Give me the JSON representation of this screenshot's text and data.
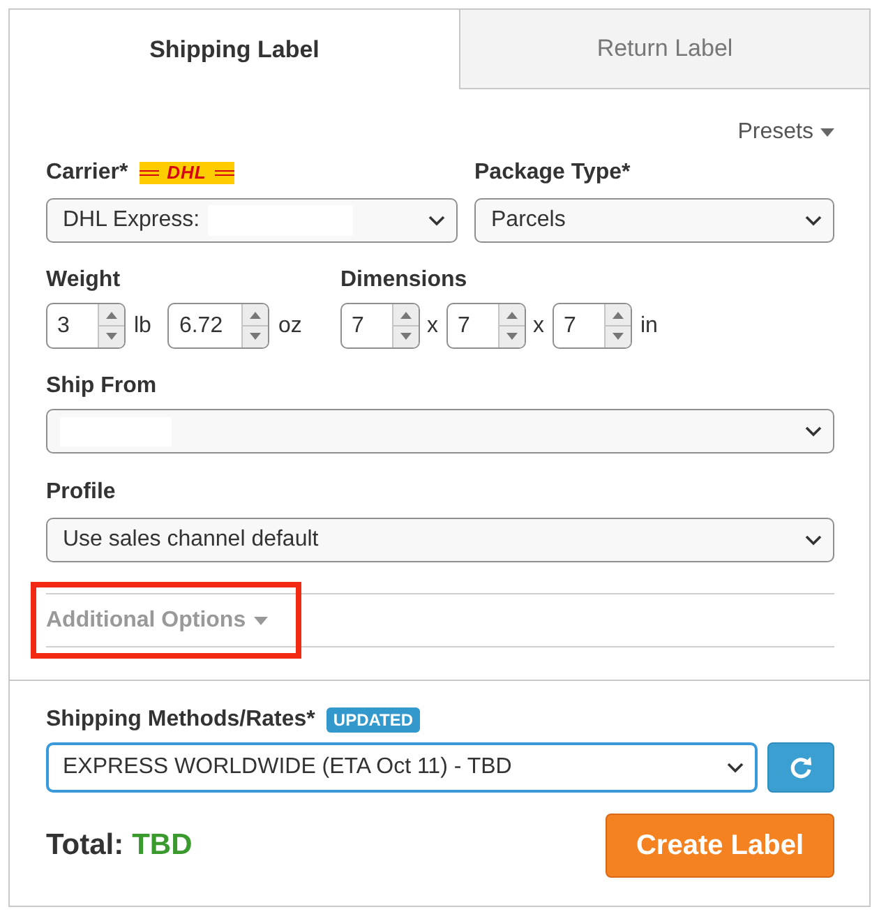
{
  "tabs": [
    {
      "label": "Shipping Label",
      "selected": true
    },
    {
      "label": "Return Label",
      "selected": false
    }
  ],
  "presets": {
    "label": "Presets"
  },
  "carrier": {
    "label": "Carrier*",
    "logo": "DHL",
    "value": "DHL Express:",
    "redacted": true
  },
  "package_type": {
    "label": "Package Type*",
    "value": "Parcels"
  },
  "weight": {
    "label": "Weight",
    "inputs": [
      {
        "value": "3",
        "unit": "lb"
      },
      {
        "value": "6.72",
        "unit": "oz"
      }
    ]
  },
  "dimensions": {
    "label": "Dimensions",
    "values": [
      "7",
      "7",
      "7"
    ],
    "separators": [
      "x",
      "x"
    ],
    "unit": "in"
  },
  "ship_from": {
    "label": "Ship From",
    "redacted": true
  },
  "profile": {
    "label": "Profile",
    "value": "Use sales channel default"
  },
  "additional_options": {
    "label": "Additional Options",
    "expanded": false,
    "highlighted": true
  },
  "shipping_methods": {
    "label": "Shipping Methods/Rates*",
    "badge": "UPDATED",
    "value": "EXPRESS WORLDWIDE (ETA Oct 11) - TBD",
    "focused": true
  },
  "total": {
    "label": "Total:",
    "value": "TBD"
  },
  "create_button": {
    "label": "Create Label"
  }
}
